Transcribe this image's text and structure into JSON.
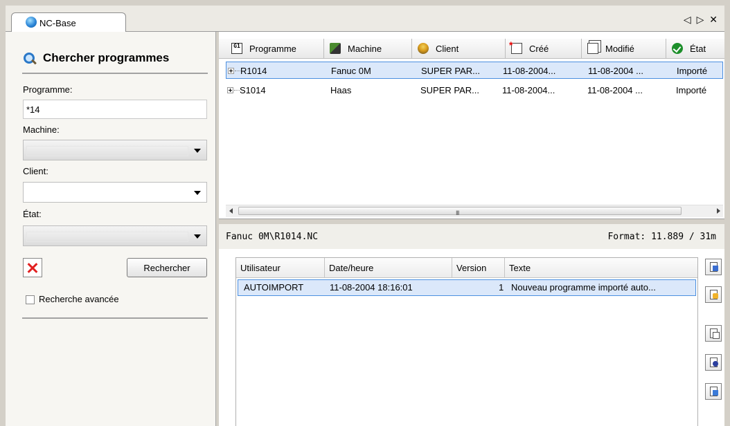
{
  "tab": {
    "label": "NC-Base",
    "ctrl_prev": "◁",
    "ctrl_next": "▷",
    "ctrl_close": "✕"
  },
  "search": {
    "title": "Chercher programmes",
    "programme_label": "Programme:",
    "programme_value": "*14",
    "machine_label": "Machine:",
    "machine_value": "",
    "client_label": "Client:",
    "client_value": "",
    "etat_label": "État:",
    "etat_value": "",
    "search_button": "Rechercher",
    "advanced_label": "Recherche avancée",
    "advanced_checked": false
  },
  "grid": {
    "columns": [
      "Programme",
      "Machine",
      "Client",
      "Créé",
      "Modifié",
      "État"
    ],
    "rows": [
      {
        "programme": "R1014",
        "machine": "Fanuc 0M",
        "client": "SUPER PAR...",
        "cree": "11-08-2004...",
        "modifie": "11-08-2004 ...",
        "etat": "Importé",
        "selected": true
      },
      {
        "programme": "S1014",
        "machine": "Haas",
        "client": "SUPER PAR...",
        "cree": "11-08-2004...",
        "modifie": "11-08-2004 ...",
        "etat": "Importé",
        "selected": false
      }
    ],
    "scroll_grip": "III"
  },
  "details": {
    "path": "Fanuc 0M\\R1014.NC",
    "format": "Format: 11.889 / 31m"
  },
  "history": {
    "columns": [
      "Utilisateur",
      "Date/heure",
      "Version",
      "Texte"
    ],
    "rows": [
      {
        "utilisateur": "AUTOIMPORT",
        "date": "11-08-2004 18:16:01",
        "version": "1",
        "texte": "Nouveau programme importé auto..."
      }
    ]
  },
  "side_icons": [
    "new-document-icon",
    "edit-document-icon",
    "copy-document-icon",
    "view-document-icon",
    "transfer-document-icon"
  ]
}
